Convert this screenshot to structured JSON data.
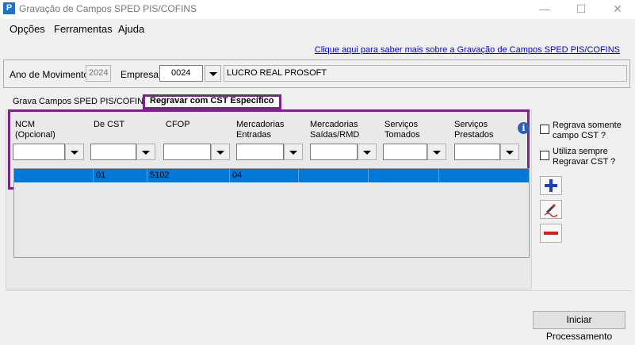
{
  "window": {
    "title": "Gravação de Campos SPED PIS/COFINS",
    "icon_letter": "P",
    "minimize": "—",
    "maximize": "☐",
    "close": "✕"
  },
  "menu": [
    "Opções",
    "Ferramentas",
    "Ajuda"
  ],
  "help_link": "Clique aqui para saber mais sobre a Gravação de Campos SPED PIS/COFINS",
  "filters": {
    "ano_label": "Ano de Movimento:",
    "ano_value": "2024",
    "empresa_label": "Empresa:",
    "empresa_value": "0024",
    "empresa_name": "LUCRO REAL PROSOFT"
  },
  "tabs": [
    "Grava Campos SPED PIS/COFINS",
    "Regravar com CST Específico"
  ],
  "columns": [
    "NCM\n(Opcional)",
    "De CST",
    "CFOP",
    "Mercadorias\nEntradas",
    "Mercadorias\nSaídas/RMD",
    "Serviços\nTomados",
    "Serviços\nPrestados"
  ],
  "grid_row": [
    "",
    "01",
    "5102",
    "04",
    "",
    "",
    ""
  ],
  "options": {
    "regrava_label": "Regrava somente\ncampo CST ?",
    "utiliza_label": "Utiliza sempre\nRegravar CST ?"
  },
  "info_glyph": "i",
  "side_buttons": [
    "add-icon",
    "edit-icon",
    "remove-icon"
  ],
  "colors": {
    "accent_highlight": "#7b2389",
    "selection": "#0078d7",
    "link": "#0000ee"
  },
  "run_button": "Iniciar Processamento"
}
